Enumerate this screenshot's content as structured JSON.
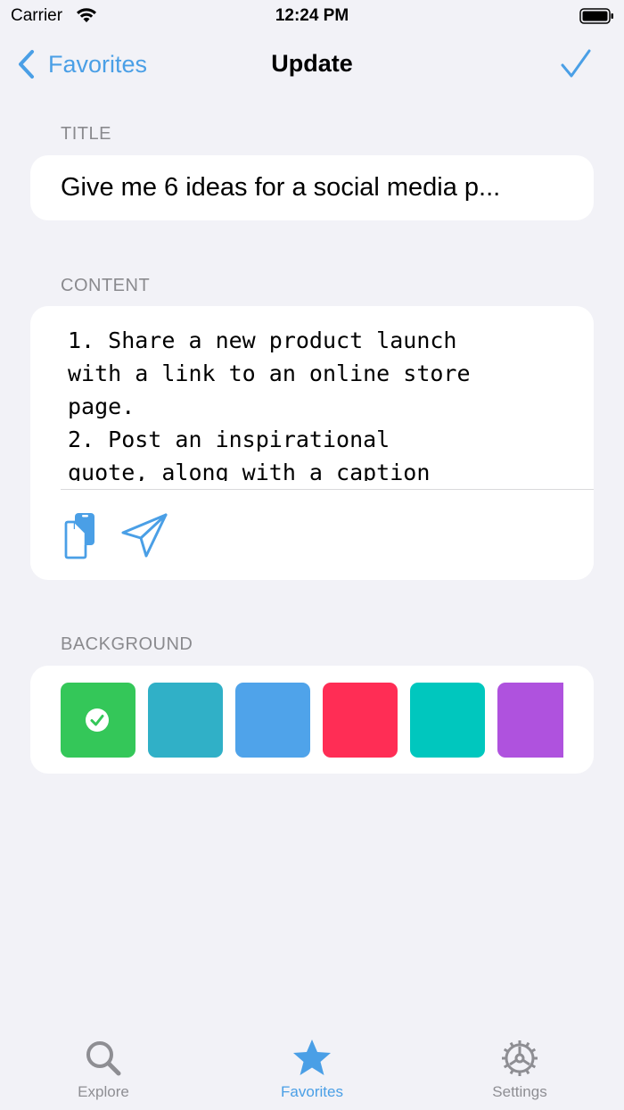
{
  "status_bar": {
    "carrier": "Carrier",
    "time": "12:24 PM"
  },
  "nav": {
    "back_label": "Favorites",
    "title": "Update",
    "done_icon": "checkmark-icon"
  },
  "title_section": {
    "header": "TITLE",
    "value": "Give me 6 ideas for a social media p..."
  },
  "content_section": {
    "header": "CONTENT",
    "text": "1. Share a new product launch\nwith a link to an online store\npage.\n2. Post an inspirational\nquote, along with a caption",
    "actions": [
      "copy-icon",
      "send-icon"
    ]
  },
  "background_section": {
    "header": "BACKGROUND",
    "colors": [
      "#34c759",
      "#30b0c7",
      "#4fa3ea",
      "#ff2d55",
      "#00c7be",
      "#af52de"
    ],
    "selected_index": 0
  },
  "tabbar": {
    "tabs": [
      {
        "label": "Explore",
        "icon": "magnifier-icon",
        "active": false
      },
      {
        "label": "Favorites",
        "icon": "star-icon",
        "active": true
      },
      {
        "label": "Settings",
        "icon": "gear-icon",
        "active": false
      }
    ]
  },
  "colors": {
    "accent": "#4a9fe6",
    "background": "#f2f2f7",
    "card": "#ffffff",
    "secondary_text": "#8a8a8e"
  }
}
